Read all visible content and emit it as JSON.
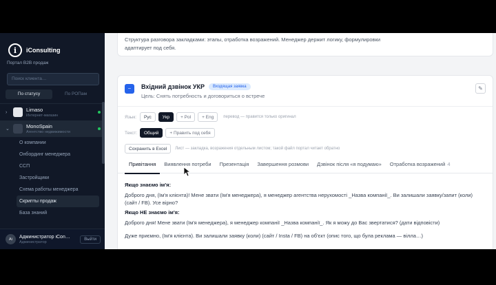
{
  "sidebar": {
    "brand": "iConsulting",
    "portal_label": "Портал B2B продаж",
    "search_placeholder": "Поиск клиента…",
    "filters": [
      "По статусу",
      "По РОПам"
    ],
    "clients": [
      {
        "name": "Limaso",
        "sub": "Интернет-магазин",
        "status_color": "#22c55e"
      },
      {
        "name": "MonoSpain",
        "sub": "Агентство недвижимости",
        "status_color": "#22c55e"
      }
    ],
    "nav": [
      "О компании",
      "Онбординг менеджера",
      "ССП",
      "Застройщики",
      "Схема работы менеджера",
      "Скрипты продаж",
      "База знаний"
    ],
    "active_nav_index": 5,
    "user": {
      "initials": "Ai",
      "name": "Администратор iCon…",
      "role": "Администратор",
      "logout": "Выйти"
    }
  },
  "main": {
    "top_card_text": "Структура разговора закладками: этапы, отработка возражений. Менеджер держит логику, формулировки адаптирует под себя.",
    "script": {
      "title": "Вхідний дзвінок УКР",
      "badge": "Входящая заявка",
      "goal": "Цель: Снять потребность и договориться о встрече",
      "lang_label": "Язык:",
      "langs": [
        "Рус",
        "Укр",
        "+ Pol",
        "+ Eng"
      ],
      "active_lang_index": 1,
      "lang_note": "перевод — правится только оригинал",
      "text_label": "Текст:",
      "text_modes": [
        "Общий",
        "+ Править под себя"
      ],
      "excel_button": "Сохранить в Excel",
      "excel_note": "Лист — закладка, возражения отдельным листом; такой файл портал читает обратно",
      "tabs": [
        "Привітання",
        "Виявлення потреби",
        "Презентація",
        "Завершення розмови",
        "Дзвінок після «я подумаю»",
        "Отработка возражений"
      ],
      "tab_count": "4",
      "active_tab_index": 0,
      "content": [
        {
          "heading": "Якщо знаємо ім'я:",
          "text": "Доброго дня, (Ім'я клієнта)! Мене звати (Ім'я менеджера), я менеджер агентства нерухомості _Назва компанії_. Ви залишали заявку/запит (коли) (сайт / FB). Усе вірно?"
        },
        {
          "heading": "Якщо НЕ знаємо ім'я:",
          "text": "Доброго дня! Мене звати (Ім'я менеджера), я менеджер компанії _Назва компанії_. Як я можу до Вас звертатися? (дати відповісти)"
        },
        {
          "heading": "",
          "text": "Дуже приємно, (Ім'я клієнта). Ви залишали заявку (коли) (сайт / Insta / FB) на об'єкт (опис того, що була реклама — вілла…)"
        }
      ]
    }
  }
}
